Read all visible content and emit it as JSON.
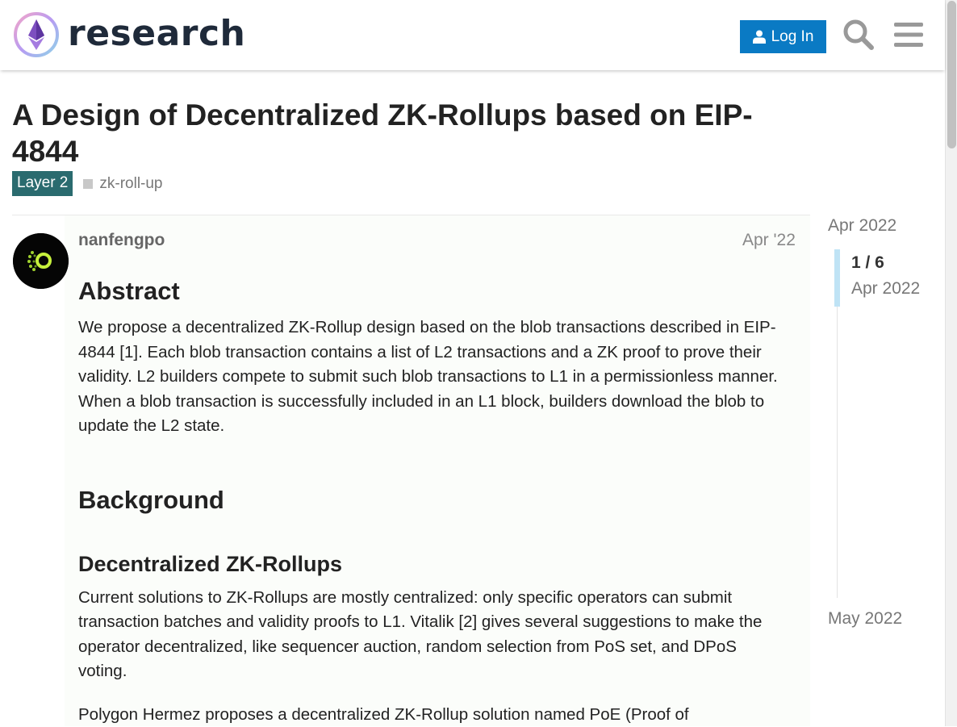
{
  "header": {
    "site_name": "research",
    "login_label": "Log In"
  },
  "topic": {
    "title": "A Design of Decentralized ZK-Rollups based on EIP-4844",
    "category": "Layer 2",
    "tag": "zk-roll-up"
  },
  "post": {
    "author": "nanfengpo",
    "date": "Apr '22",
    "sections": {
      "abstract_heading": "Abstract",
      "abstract_text": "We propose a decentralized ZK-Rollup design based on the blob transactions described in EIP-4844 [1]. Each blob transaction contains a list of L2 transactions and a ZK proof to prove their validity. L2 builders compete to submit such blob transactions to L1 in a permissionless manner. When a blob transaction is successfully included in an L1 block, builders download the blob to update the L2 state.",
      "background_heading": "Background",
      "decentralized_heading": "Decentralized ZK-Rollups",
      "decentralized_text": "Current solutions to ZK-Rollups are mostly centralized: only specific operators can submit transaction batches and validity proofs to L1. Vitalik [2] gives several suggestions to make the operator decentralized, like sequencer auction, random selection from PoS set, and DPoS voting.",
      "polygon_text": "Polygon Hermez proposes a decentralized ZK-Rollup solution named PoE (Proof of"
    }
  },
  "timeline": {
    "start": "Apr 2022",
    "position": "1 / 6",
    "current_date": "Apr 2022",
    "end": "May 2022"
  },
  "colors": {
    "accent": "#0a7ac4",
    "category": "#2a6b6f",
    "timeline_handle": "#bfe3f5"
  },
  "icons": {
    "logo": "ethereum-research-logo",
    "login": "user-icon",
    "search": "search-icon",
    "menu": "hamburger-menu-icon"
  }
}
